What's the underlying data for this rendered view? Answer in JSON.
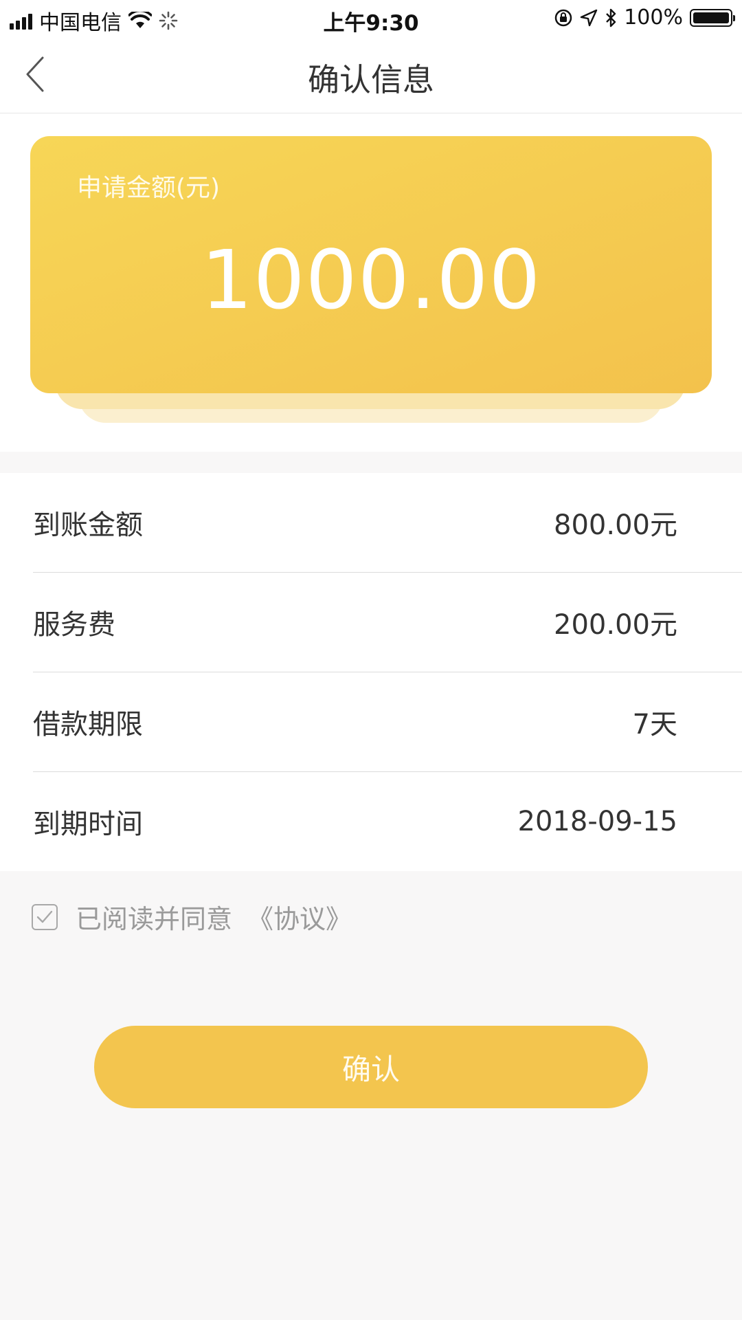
{
  "status_bar": {
    "carrier": "中国电信",
    "time": "上午9:30",
    "battery": "100%",
    "battery_level": 1.0
  },
  "nav": {
    "title": "确认信息",
    "back_icon": "chevron-left-icon"
  },
  "hero": {
    "label": "申请金额(元)",
    "amount": "1000.00",
    "colors": {
      "gradient_start": "#f7d657",
      "gradient_end": "#f3c24c"
    }
  },
  "details": [
    {
      "label": "到账金额",
      "value": "800.00元"
    },
    {
      "label": "服务费",
      "value": "200.00元"
    },
    {
      "label": "借款期限",
      "value": "7天"
    },
    {
      "label": "到期时间",
      "value": "2018-09-15"
    }
  ],
  "agreement": {
    "text": "已阅读并同意",
    "link": "《协议》",
    "checked": true
  },
  "confirm_button": {
    "label": "确认",
    "color": "#f3c54e"
  }
}
